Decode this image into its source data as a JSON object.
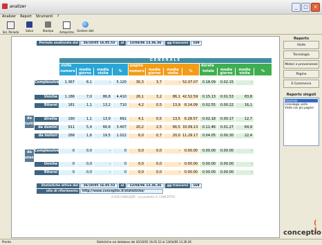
{
  "window": {
    "title": "analizer"
  },
  "menu": [
    "Analizer",
    "Report",
    "Strumenti",
    "?"
  ],
  "toolbar": [
    {
      "label": "Sel. Periodo",
      "icon": "calendar-icon"
    },
    {
      "label": "Salva",
      "icon": "save-icon"
    },
    {
      "label": "Stampa",
      "icon": "printer-icon"
    },
    {
      "label": "Anteprima",
      "icon": "preview-icon"
    },
    {
      "label": "Gestore dati",
      "icon": "globe-icon"
    }
  ],
  "report": {
    "period": {
      "label": "Periodo analizzato dal",
      "from": "26/10/05 16.05.53",
      "al": "al",
      "to": "13/04/06 13.36.36",
      "days_label": "gg trascorsi",
      "days": "169"
    },
    "generale": "GENERALE",
    "groups": {
      "visite": "visite",
      "pagine": "pagine",
      "durata": "durata"
    },
    "columns": [
      "numero",
      "media giorno",
      "media visita",
      "%",
      "numero",
      "media giorno",
      "media visita",
      "%",
      "totale",
      "media giorno",
      "media visita",
      "%"
    ],
    "noti_label": "da tutti",
    "noti_rows": [
      {
        "label": "Complessive",
        "v": [
          "1.367",
          "8,1",
          "-",
          "5.120",
          "30,3",
          "3,7",
          "-",
          "52.07.07",
          "0.18.09",
          "0.02.15",
          "-"
        ]
      },
      {
        "label": "Uniche",
        "v": [
          "1.186",
          "7,0",
          "86,8",
          "4.410",
          "26,1",
          "3,2",
          "86,1",
          "42.52.59",
          "0.15.13",
          "0.01.53",
          "83,8"
        ]
      },
      {
        "label": "Ritorni",
        "v": [
          "181",
          "1,1",
          "13,2",
          "710",
          "4,2",
          "0,5",
          "13,9",
          "8.14.09",
          "0.02.55",
          "0.00.22",
          "16,1"
        ]
      },
      {
        "label": "dirette",
        "v": [
          "190",
          "1,1",
          "13,9",
          "691",
          "4,1",
          "0,5",
          "13,5",
          "6.28.57",
          "0.02.18",
          "0.00.17",
          "12,7"
        ]
      },
      {
        "label": "da domini",
        "v": [
          "911",
          "5,4",
          "66,6",
          "3.407",
          "20,2",
          "2,5",
          "66,5",
          "33.09.13",
          "0.11.46",
          "0.01.27",
          "64,9"
        ]
      },
      {
        "label": "da motori",
        "v": [
          "266",
          "1,6",
          "19,5",
          "1.022",
          "6,0",
          "0,7",
          "20,0",
          "11.29.17",
          "0.04.05",
          "0.00.30",
          "22,4"
        ]
      }
    ],
    "ignoti_label": "da utenti",
    "ignoti_rows": [
      {
        "label": "Complessive",
        "v": [
          "0",
          "0,0",
          "-",
          "0",
          "0,0",
          "0,0",
          "-",
          "0.00.00",
          "0.00.00",
          "0.00.00",
          "-"
        ]
      },
      {
        "label": "Uniche",
        "v": [
          "0",
          "0,0",
          "-",
          "0",
          "0,0",
          "0,0",
          "-",
          "0.00.00",
          "0.00.00",
          "0.00.00",
          "-"
        ]
      },
      {
        "label": "Ritorni",
        "v": [
          "0",
          "0,0",
          "-",
          "0",
          "0,0",
          "0,0",
          "-",
          "0.00.00",
          "0.00.00",
          "0.00.00",
          "-"
        ]
      }
    ],
    "footer": {
      "stats_label": "Statistiche attive dal",
      "from": "26/10/05 16.05.53",
      "al": "al",
      "to": "13/04/06 13.36.36",
      "days_label": "gg trascorsi",
      "days": "169",
      "site_label": "sito di riferimento",
      "site": "http://www.conceptio.it/statistiche/",
      "copyright": "©2003 ANALIZER - un prodotto © CONCEPTIO"
    }
  },
  "sidebar": {
    "reports_title": "Reports",
    "buttons": [
      "Visite",
      "Tecnologia",
      "Motori e provenienze",
      "Pagine",
      "E-Commerce"
    ],
    "single_title": "Reports singoli",
    "list": [
      "Generale",
      "Cronologia visite",
      "Visite con più pagine"
    ]
  },
  "logo": {
    "bracket": "( ]",
    "text": "conceptio"
  },
  "status": {
    "left": "Pronto",
    "text": "Statistiche sul database dal 26/10/05 16.05.53 al 13/04/06 13.36.36"
  },
  "colors": {
    "accent_blue": "#3f647f",
    "teal": "#3f8fa3",
    "visite": "#2aa6d6",
    "pagine": "#f39c16",
    "durata": "#3fae50"
  }
}
